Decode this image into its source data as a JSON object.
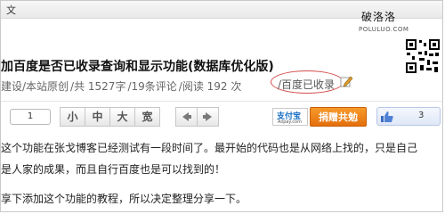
{
  "window": {
    "tab_fragment": "文"
  },
  "brand": {
    "name": "破洛洛",
    "url": "POLULUO.COM"
  },
  "article": {
    "title": "加百度是否已收录查询和显示功能(数据库优化版)",
    "meta": {
      "category": "建设/本站原创",
      "words": "/共 1527字",
      "comments": "/19条评论",
      "views": "/阅读 192 次",
      "indexed_status": "/百度已收录"
    },
    "paragraphs": [
      "这个功能在张戈博客已经测试有一段时间了。最开始的代码也是从网络上找的，只是自己",
      "是人家的成果，而且自行百度也是可以找到的！",
      "享下添加这个功能的教程，所以决定整理分享一下。"
    ]
  },
  "toolbar": {
    "page_value": "1",
    "font_sizes": [
      "小",
      "中",
      "大",
      "宽"
    ],
    "nav_prev": "◆",
    "nav_next": "➜",
    "alipay_cn": "支付宝",
    "alipay_en": "Alipay.com",
    "donate_label": "捐赠共勉",
    "like_count": "3"
  },
  "colors": {
    "accent_orange": "#f08a1e",
    "circle_red": "#d34c4c",
    "alipay_blue": "#1a6fc4"
  }
}
